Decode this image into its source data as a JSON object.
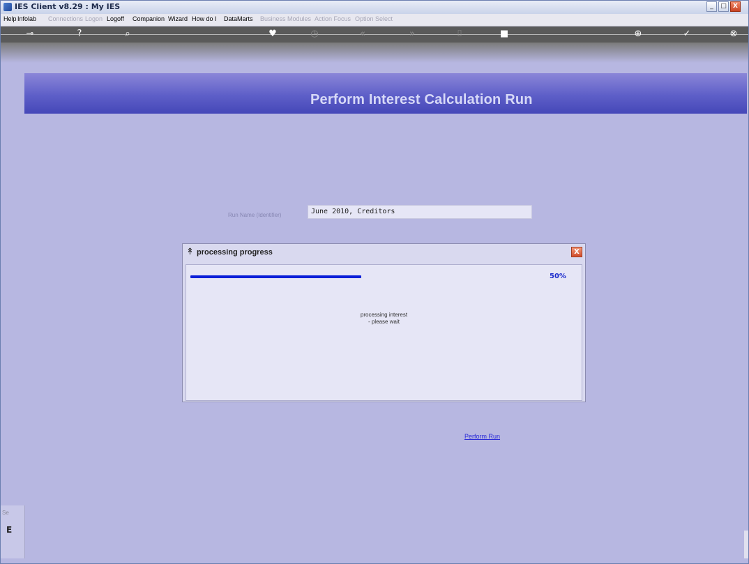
{
  "window": {
    "title": "IES Client v8.29 : My IES",
    "controls": {
      "minimize": "_",
      "maximize": "□",
      "close": "X"
    }
  },
  "menubar": {
    "items": [
      {
        "label": "Help",
        "enabled": true
      },
      {
        "label": "Infolab",
        "enabled": true
      },
      {
        "label": "Connections",
        "enabled": false
      },
      {
        "label": "Logon",
        "enabled": false
      },
      {
        "label": "Logoff",
        "enabled": true
      },
      {
        "label": "Companion",
        "enabled": true
      },
      {
        "label": "Wizard",
        "enabled": true
      },
      {
        "label": "How do I",
        "enabled": true
      },
      {
        "label": "DataMarts",
        "enabled": true
      },
      {
        "label": "Business Modules",
        "enabled": false
      },
      {
        "label": "Action Focus",
        "enabled": false
      },
      {
        "label": "Option Select",
        "enabled": false
      }
    ]
  },
  "toolbar": {
    "icons": [
      {
        "name": "key-icon",
        "glyph": "⊸",
        "enabled": true
      },
      {
        "name": "help-icon",
        "glyph": "?",
        "enabled": true
      },
      {
        "name": "search-icon",
        "glyph": "⌕",
        "enabled": true
      },
      {
        "name": "heart-icon",
        "glyph": "♥",
        "enabled": true
      },
      {
        "name": "clock-icon",
        "glyph": "◷",
        "enabled": false
      },
      {
        "name": "rewind-icon",
        "glyph": "«",
        "enabled": false
      },
      {
        "name": "fast-forward-icon",
        "glyph": "»",
        "enabled": false
      },
      {
        "name": "bracket-icon",
        "glyph": "⌷",
        "enabled": false
      },
      {
        "name": "stop-icon",
        "glyph": "■",
        "enabled": true
      },
      {
        "name": "plus-icon",
        "glyph": "⊕",
        "enabled": true
      },
      {
        "name": "check-icon",
        "glyph": "✓",
        "enabled": true
      },
      {
        "name": "close-circle-icon",
        "glyph": "⊗",
        "enabled": true
      }
    ]
  },
  "page": {
    "title": "Perform Interest Calculation Run",
    "run_name_label": "Run Name (Identifier)",
    "run_name_value": "June 2010, Creditors",
    "perform_run_link": "Perform Run"
  },
  "dialog": {
    "icon": "↟",
    "title": "processing progress",
    "close": "X",
    "progress_fraction": 0.5,
    "progress_label": "50%",
    "message_line1": "processing interest",
    "message_line2": "- please wait"
  },
  "side_panel": {
    "label": "Se",
    "glyph": "E"
  },
  "colors": {
    "background": "#b7b7e1",
    "banner": "#5e5fc8",
    "progress": "#0a1fd8",
    "link": "#2a2ad8"
  }
}
